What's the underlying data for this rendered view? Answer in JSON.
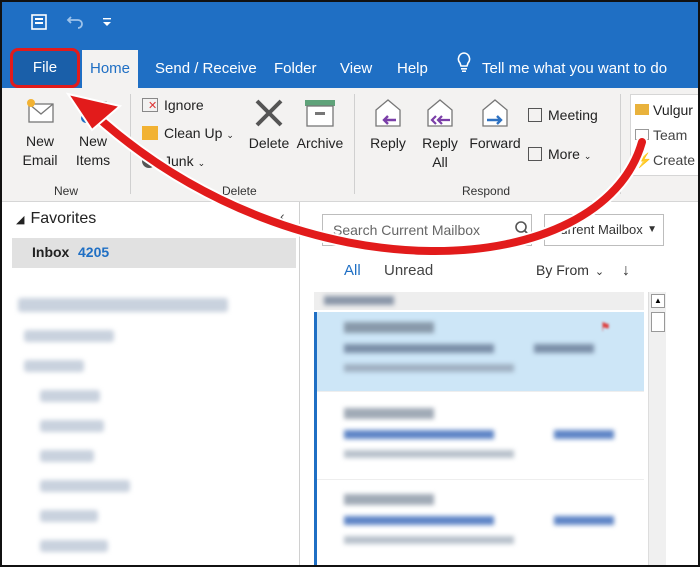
{
  "quick_access": {
    "icons": [
      "send-receive-icon",
      "undo-icon",
      "customize-icon"
    ]
  },
  "tabs": [
    {
      "label": "File"
    },
    {
      "label": "Home"
    },
    {
      "label": "Send / Receive"
    },
    {
      "label": "Folder"
    },
    {
      "label": "View"
    },
    {
      "label": "Help"
    }
  ],
  "tell_me": "Tell me what you want to do",
  "ribbon": {
    "new_group": {
      "label": "New",
      "new_email": [
        "New",
        "Email"
      ],
      "new_items": [
        "New",
        "Items"
      ]
    },
    "delete_group": {
      "label": "Delete",
      "ignore": "Ignore",
      "clean_up": "Clean Up",
      "junk": "Junk",
      "delete": "Delete",
      "archive": "Archive"
    },
    "respond_group": {
      "label": "Respond",
      "reply": "Reply",
      "reply_all": [
        "Reply",
        "All"
      ],
      "forward": "Forward",
      "meeting": "Meeting",
      "more": "More"
    },
    "quick_steps": {
      "items": [
        "Vulgur",
        "Team",
        "Create"
      ]
    }
  },
  "folders": {
    "favorites": "Favorites",
    "inbox": "Inbox",
    "inbox_count": "4205"
  },
  "list": {
    "search_placeholder": "Search Current Mailbox",
    "scope": "Current Mailbox",
    "filter_all": "All",
    "filter_unread": "Unread",
    "sort": "By From"
  },
  "colors": {
    "titlebar": "#1f6fc4",
    "ribbon": "#f3f2f1",
    "highlight": "#e21b1b",
    "selected_message": "#cde6f7"
  }
}
